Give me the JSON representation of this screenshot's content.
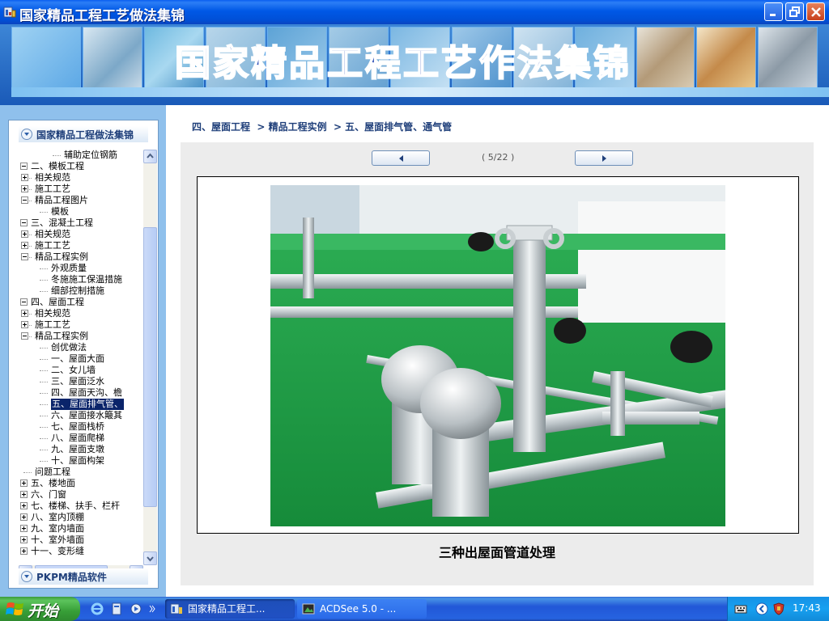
{
  "window": {
    "title": "国家精品工程工艺做法集锦"
  },
  "banner": {
    "title": "国家精品工程工艺作法集锦"
  },
  "sidebar": {
    "header": "国家精品工程做法集锦",
    "footer": "PKPM精品软件",
    "tree": [
      {
        "label": "辅助定位钢筋",
        "level": 3,
        "expander": null
      },
      {
        "label": "二、模板工程",
        "level": 0,
        "expander": "minus"
      },
      {
        "label": "相关规范",
        "level": 1,
        "expander": "plus"
      },
      {
        "label": "施工工艺",
        "level": 1,
        "expander": "plus"
      },
      {
        "label": "精品工程图片",
        "level": 1,
        "expander": "minus"
      },
      {
        "label": "模板",
        "level": 2,
        "expander": null
      },
      {
        "label": "三、混凝土工程",
        "level": 0,
        "expander": "minus"
      },
      {
        "label": "相关规范",
        "level": 1,
        "expander": "plus"
      },
      {
        "label": "施工工艺",
        "level": 1,
        "expander": "plus"
      },
      {
        "label": "精品工程实例",
        "level": 1,
        "expander": "minus"
      },
      {
        "label": "外观质量",
        "level": 2,
        "expander": null
      },
      {
        "label": "冬施施工保温措施",
        "level": 2,
        "expander": null
      },
      {
        "label": "细部控制措施",
        "level": 2,
        "expander": null
      },
      {
        "label": "四、屋面工程",
        "level": 0,
        "expander": "minus"
      },
      {
        "label": "相关规范",
        "level": 1,
        "expander": "plus"
      },
      {
        "label": "施工工艺",
        "level": 1,
        "expander": "plus"
      },
      {
        "label": "精品工程实例",
        "level": 1,
        "expander": "minus"
      },
      {
        "label": "创优做法",
        "level": 2,
        "expander": null
      },
      {
        "label": "一、屋面大面",
        "level": 2,
        "expander": null
      },
      {
        "label": "二、女儿墙",
        "level": 2,
        "expander": null
      },
      {
        "label": "三、屋面泛水",
        "level": 2,
        "expander": null
      },
      {
        "label": "四、屋面天沟、檐",
        "level": 2,
        "expander": null
      },
      {
        "label": "五、屋面排气管、",
        "level": 2,
        "expander": null,
        "selected": true
      },
      {
        "label": "六、屋面接水簸其",
        "level": 2,
        "expander": null
      },
      {
        "label": "七、屋面栈桥",
        "level": 2,
        "expander": null
      },
      {
        "label": "八、屋面爬梯",
        "level": 2,
        "expander": null
      },
      {
        "label": "九、屋面支墩",
        "level": 2,
        "expander": null
      },
      {
        "label": "十、屋面构架",
        "level": 2,
        "expander": null
      },
      {
        "label": "问题工程",
        "level": 1,
        "expander": null
      },
      {
        "label": "五、楼地面",
        "level": 0,
        "expander": "plus"
      },
      {
        "label": "六、门窗",
        "level": 0,
        "expander": "plus"
      },
      {
        "label": "七、楼梯、扶手、栏杆",
        "level": 0,
        "expander": "plus"
      },
      {
        "label": "八、室内顶棚",
        "level": 0,
        "expander": "plus"
      },
      {
        "label": "九、室内墙面",
        "level": 0,
        "expander": "plus"
      },
      {
        "label": "十、室外墙面",
        "level": 0,
        "expander": "plus"
      },
      {
        "label": "十一、变形缝",
        "level": 0,
        "expander": "plus"
      }
    ]
  },
  "content": {
    "breadcrumb": "四、屋面工程  > 精品工程实例  > 五、屋面排气管、通气管",
    "page_indicator": "( 5/22 )",
    "caption": "三种出屋面管道处理"
  },
  "taskbar": {
    "start_label": "开始",
    "tasks": [
      {
        "label": "国家精品工程工...",
        "active": true
      },
      {
        "label": "ACDSee 5.0 - ...",
        "active": false
      }
    ],
    "clock": "17:43"
  },
  "colors": {
    "accent": "#0058e6",
    "roof_green": "#1fa24a",
    "selection": "#0a246a"
  }
}
